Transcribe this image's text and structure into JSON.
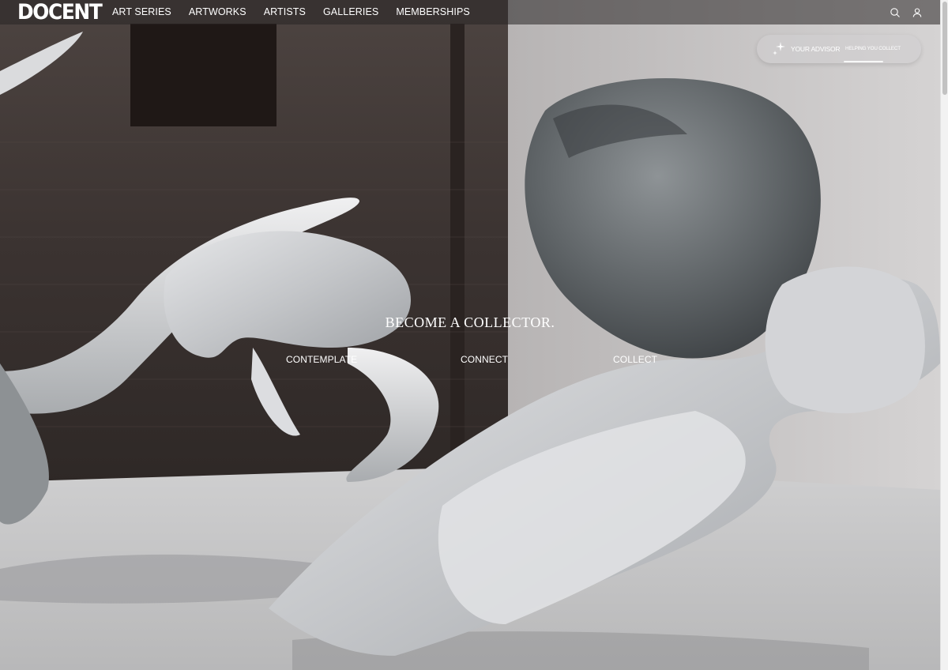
{
  "brand": {
    "logo_text": "DOCENT"
  },
  "nav": {
    "items": [
      {
        "label": "ART SERIES"
      },
      {
        "label": "ARTWORKS"
      },
      {
        "label": "ARTISTS"
      },
      {
        "label": "GALLERIES"
      },
      {
        "label": "MEMBERSHIPS"
      }
    ],
    "icons": [
      "search-icon",
      "user-icon"
    ]
  },
  "advisor": {
    "label": "YOUR ADVISOR",
    "sub_label": "HELPING YOU COLLECT",
    "icon": "sparkle-icon"
  },
  "hero": {
    "headline": "BECOME A COLLECTOR.",
    "links": [
      {
        "label": "CONTEMPLATE"
      },
      {
        "label": "CONNECT"
      },
      {
        "label": "COLLECT"
      }
    ]
  },
  "colors": {
    "nav_text": "#ffffff",
    "nav_bg": "#282424"
  }
}
